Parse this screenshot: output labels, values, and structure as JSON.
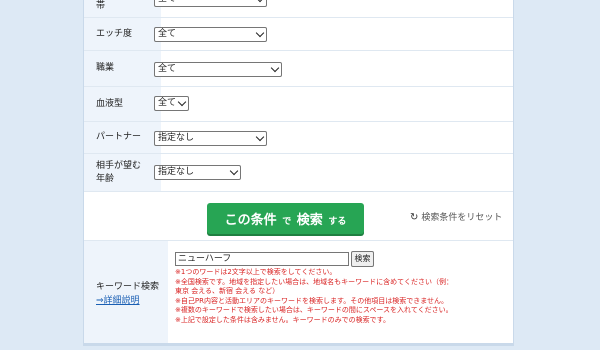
{
  "rows": [
    {
      "label": "帯",
      "select": "全て"
    },
    {
      "label": "エッチ度",
      "select": "全て"
    },
    {
      "label": "職業",
      "select": "全て"
    },
    {
      "label": "血液型",
      "select": "全て"
    },
    {
      "label": "パートナー",
      "select": "指定なし"
    },
    {
      "label_line1": "相手が望む",
      "label_line2": "年齢",
      "select": "指定なし"
    }
  ],
  "search_button": {
    "part1": "この条件",
    "part2": "で",
    "part3": "検索",
    "part4": "する"
  },
  "reset_link": "検索条件をリセット",
  "keyword": {
    "label": "キーワード検索",
    "detail_link": "⇒詳細説明",
    "input_value": "ニューハーフ",
    "button_label": "検索",
    "notes": [
      "※1つのワードは2文字以上で検索をしてください。",
      "※全国検索です。地域を指定したい場合は、地域名もキーワードに含めてください（例：",
      "東京 会える、新宿 会える など）",
      "※自己PR内容と活動エリアのキーワードを検索します。その他項目は検索できません。",
      "※複数のキーワードで検索したい場合は、キーワードの間にスペースを入れてください。",
      "※上記で設定した条件は含みません。キーワードのみでの検索です。"
    ]
  }
}
